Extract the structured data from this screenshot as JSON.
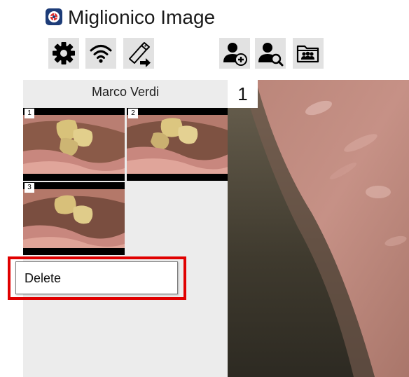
{
  "app": {
    "title": "Miglionico Image",
    "logo_color": "#1d3c78",
    "logo_accent": "#e23030"
  },
  "toolbar": {
    "left_buttons": [
      {
        "icon": "gear-icon",
        "action": "settings"
      },
      {
        "icon": "wifi-icon",
        "action": "wireless"
      },
      {
        "icon": "usb-export-icon",
        "action": "usb-export"
      }
    ],
    "right_buttons": [
      {
        "icon": "add-patient-icon",
        "action": "add-patient"
      },
      {
        "icon": "search-patient-icon",
        "action": "search-patient"
      },
      {
        "icon": "patient-folder-icon",
        "action": "patient-folder"
      }
    ],
    "button_color": "#e2e2e2"
  },
  "patient": {
    "name": "Marco Verdi"
  },
  "thumbnails": [
    {
      "number": "1"
    },
    {
      "number": "2"
    },
    {
      "number": "3"
    }
  ],
  "context_menu": {
    "items": [
      {
        "label": "Delete"
      }
    ],
    "highlight_color": "#e00000"
  },
  "viewer": {
    "image_number": "1"
  }
}
